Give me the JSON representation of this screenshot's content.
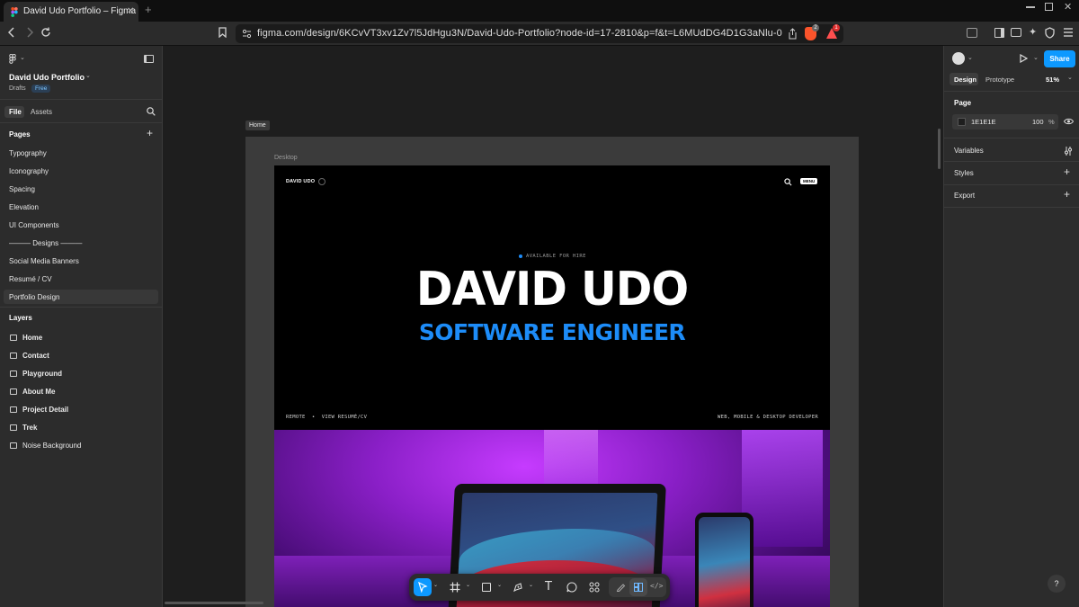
{
  "browser": {
    "tab_title": "David Udo Portfolio – Figma",
    "url": "figma.com/design/6KCvVT3xv1Zv7l5JdHgu3N/David-Udo-Portfolio?node-id=17-2810&p=f&t=L6MUdDG4D1G3aNlu-0",
    "brave_badge": "2",
    "alert_badge": "1"
  },
  "left_panel": {
    "file_name": "David Udo Portfolio",
    "drafts_label": "Drafts",
    "plan_badge": "Free",
    "tabs": {
      "file": "File",
      "assets": "Assets"
    },
    "pages_heading": "Pages",
    "pages": [
      "Typography",
      "Iconography",
      "Spacing",
      "Elevation",
      "UI Components",
      "——— Designs ———",
      "Social Media Banners",
      "Resumé / CV",
      "Portfolio Design"
    ],
    "layers_heading": "Layers",
    "layers": [
      "Home",
      "Contact",
      "Playground",
      "About Me",
      "Project Detail",
      "Trek",
      "Noise Background"
    ]
  },
  "canvas": {
    "home_tag": "Home",
    "frame_label": "Desktop",
    "design": {
      "logo": "DAVID UDO",
      "menu_label": "MENU",
      "available": "AVAILABLE FOR HIRE",
      "name": "DAVID UDO",
      "role": "SOFTWARE ENGINEER",
      "bottom_left": "REMOTE  •  VIEW RESUMÉ/CV",
      "bottom_right": "WEB, MOBILE & DESKTOP DEVELOPER"
    }
  },
  "right_panel": {
    "share_label": "Share",
    "tabs": {
      "design": "Design",
      "prototype": "Prototype"
    },
    "zoom": "51%",
    "page_heading": "Page",
    "page_color": "1E1E1E",
    "page_opacity": "100",
    "percent": "%",
    "variables": "Variables",
    "styles": "Styles",
    "export": "Export"
  },
  "help_label": "?",
  "colors": {
    "accent": "#0d99ff",
    "role_blue": "#1d8cf8",
    "panel": "#2c2c2c",
    "canvas": "#1e1e1e"
  }
}
